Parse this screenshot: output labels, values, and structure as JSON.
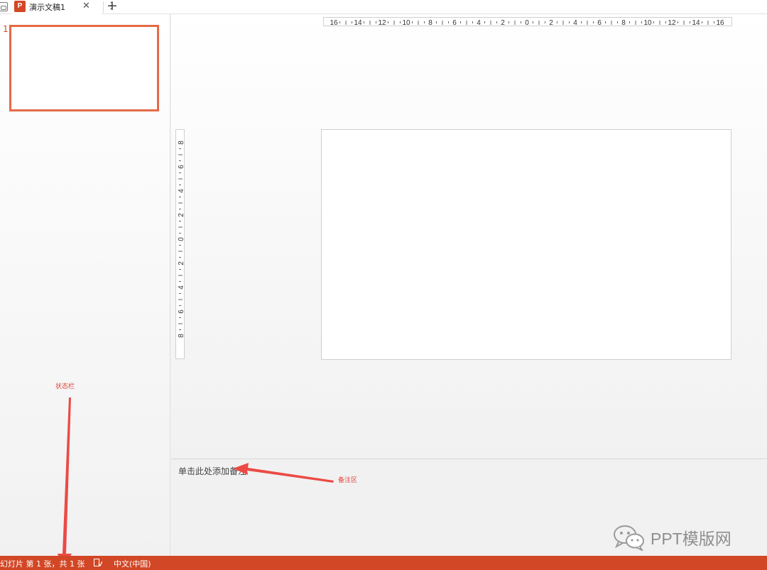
{
  "tabbar": {
    "document_title": "演示文稿1",
    "doc_icon_letter": "P",
    "close_glyph": "✕",
    "more_glyph": "⋮",
    "add_glyph": "+"
  },
  "slide_pane": {
    "thumbnails": [
      {
        "number": "1"
      }
    ],
    "selected_border_color": "#e46a45"
  },
  "rulers": {
    "horizontal_labels": [
      "16",
      "14",
      "12",
      "10",
      "8",
      "6",
      "4",
      "2",
      "0",
      "2",
      "4",
      "6",
      "8",
      "10",
      "12",
      "14",
      "16"
    ],
    "vertical_labels": [
      "8",
      "6",
      "4",
      "2",
      "0",
      "2",
      "4",
      "6",
      "8"
    ]
  },
  "notes": {
    "placeholder": "单击此处添加备注"
  },
  "annotations": {
    "status_bar_label": "状态栏",
    "notes_area_label": "备注区",
    "color": "#e2463b"
  },
  "status_bar": {
    "slide_info": "幻灯片 第 1 张，共 1 张",
    "language": "中文(中国)",
    "color": "#d24726"
  },
  "watermark": {
    "text": "PPT模版网",
    "icon": "wechat-icon"
  }
}
